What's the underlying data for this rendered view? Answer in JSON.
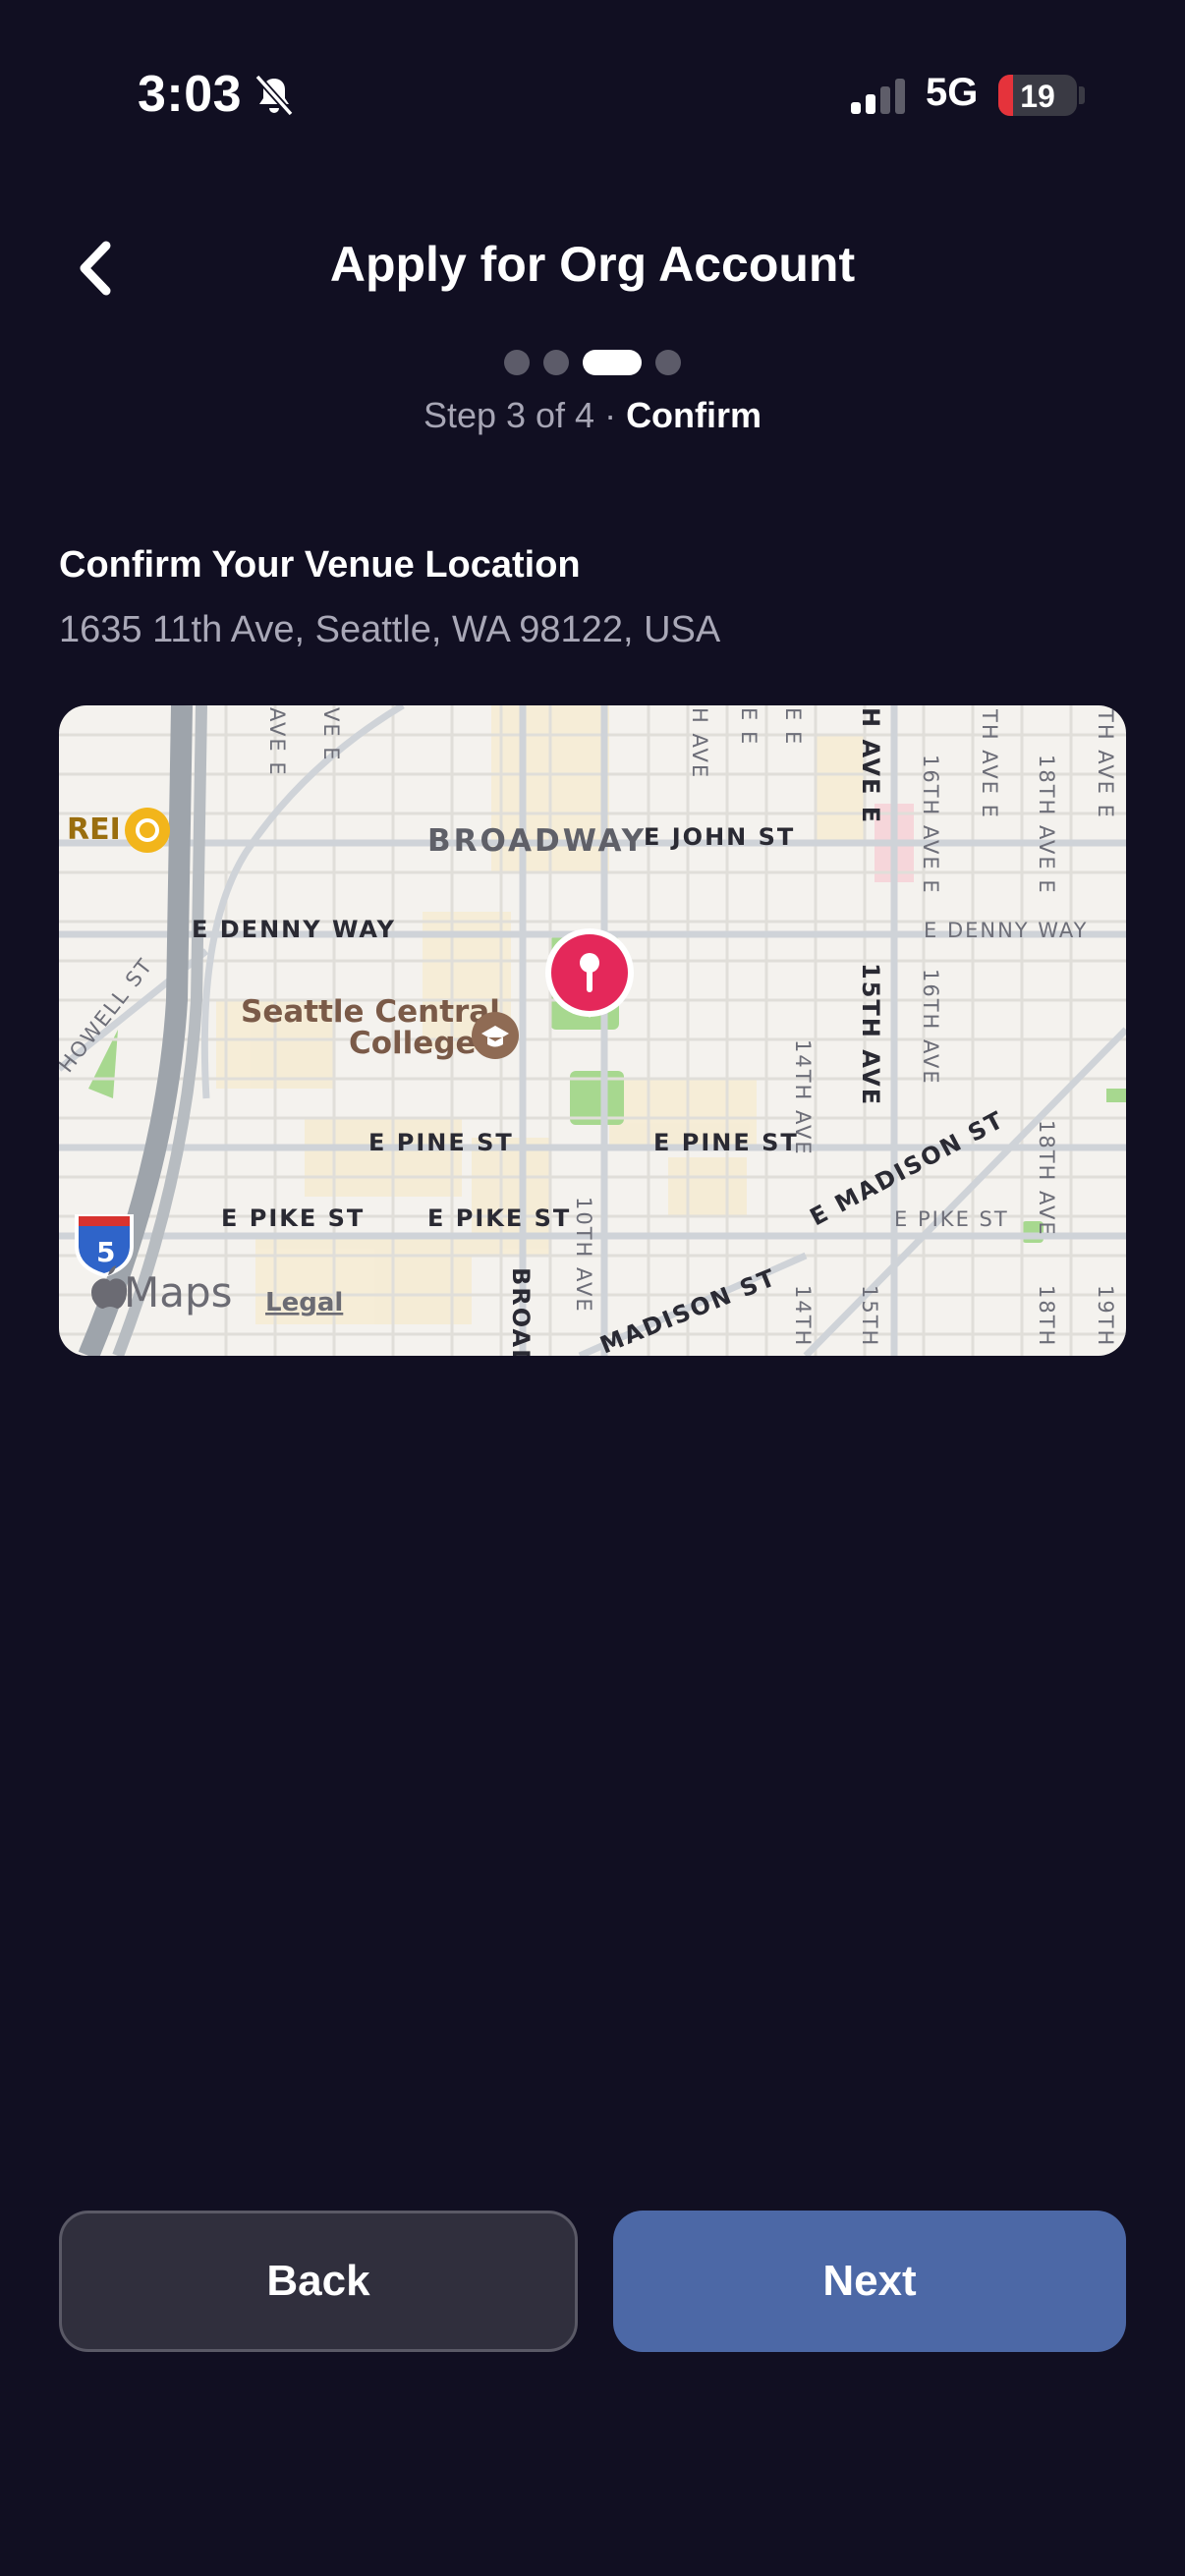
{
  "status_bar": {
    "time": "3:03",
    "network": "5G",
    "battery": "19",
    "battery_level_percent": 19,
    "icons": [
      "bell-slash-icon",
      "cellular-signal-icon",
      "battery-icon"
    ]
  },
  "header": {
    "title": "Apply for Org Account",
    "back_icon": "chevron-left-icon"
  },
  "progress": {
    "total_steps": 4,
    "current_step": 3,
    "label_prefix": "Step 3 of 4 · ",
    "label_step_name": "Confirm"
  },
  "location": {
    "heading": "Confirm Your Venue Location",
    "address": "1635 11th Ave, Seattle, WA 98122, USA"
  },
  "map": {
    "neighborhood": "BROADWAY",
    "poi_college": "Seattle Central",
    "poi_college_2": "College",
    "poi_store": "REI",
    "streets": {
      "john": "E JOHN ST",
      "denny_w": "E DENNY WAY",
      "denny_e": "E DENNY WAY",
      "pine_w": "E PINE ST",
      "pine_e": "E PINE ST",
      "pike_1": "E PIKE ST",
      "pike_2": "E PIKE ST",
      "pike_3": "E PIKE ST",
      "madison_1": "E MADISON ST",
      "madison_2": "MADISON ST",
      "howell": "HOWELL ST",
      "ave15": "15TH AVE",
      "ave15_top": "H AVE E",
      "ave15_bottom": "15TH",
      "ave16": "16TH AVE E",
      "ave16_lower": "16TH AVE",
      "ave17": "TH AVE E",
      "ave18": "18TH AVE E",
      "ave18_lower": "18TH AVE",
      "ave18_bottom": "18TH",
      "ave19": "TH AVE E",
      "ave19_bottom": "19TH",
      "ave14": "14TH AVE",
      "ave14_bottom": "14TH",
      "ave10": "10TH AVE",
      "broadway_v": "BROAD",
      "top_ave_1": "AVE E",
      "top_ave_2": "VE E",
      "top_ave_3": "H AVE",
      "top_ave_4": "E E",
      "top_ave_5": "E E"
    },
    "highway_shield": "5",
    "attribution": "Maps",
    "legal": "Legal",
    "icons": [
      "map-pin-icon",
      "graduation-cap-icon",
      "store-icon",
      "apple-logo-icon",
      "interstate-shield-icon"
    ]
  },
  "buttons": {
    "back": "Back",
    "next": "Next"
  },
  "colors": {
    "background": "#110f22",
    "next_button": "#4c68a6",
    "back_button": "#302f3d",
    "pin": "#e4285a"
  }
}
